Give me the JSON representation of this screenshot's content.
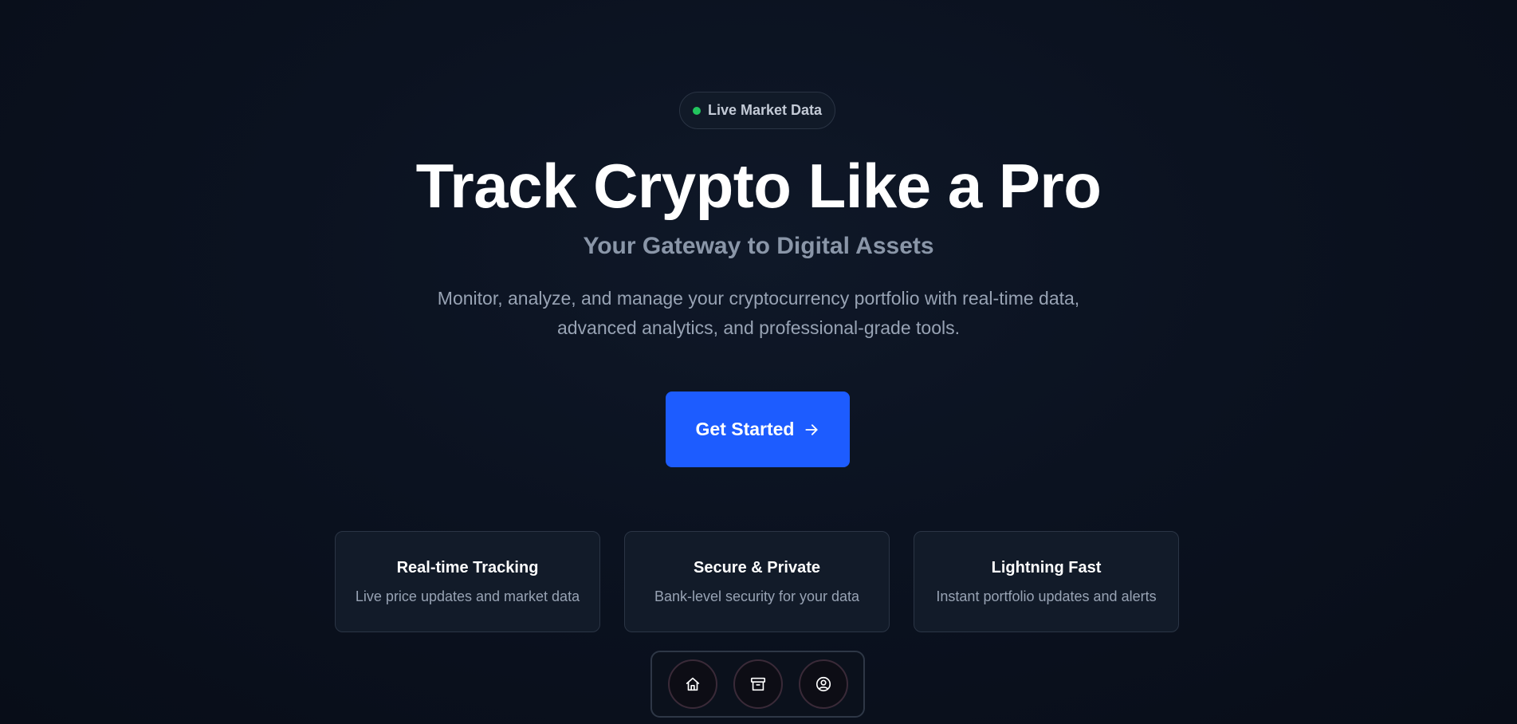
{
  "badge": {
    "label": "Live Market Data",
    "dot_color": "#22c55e"
  },
  "hero": {
    "title": "Track Crypto Like a Pro",
    "subtitle": "Your Gateway to Digital Assets",
    "description": "Monitor, analyze, and manage your cryptocurrency portfolio with real-time data, advanced analytics, and professional-grade tools."
  },
  "cta": {
    "label": "Get Started",
    "icon": "arrow-right-icon",
    "color": "#1d5cff"
  },
  "features": [
    {
      "title": "Real-time Tracking",
      "description": "Live price updates and market data"
    },
    {
      "title": "Secure & Private",
      "description": "Bank-level security for your data"
    },
    {
      "title": "Lightning Fast",
      "description": "Instant portfolio updates and alerts"
    }
  ],
  "bottom_nav": {
    "items": [
      {
        "icon": "home-icon"
      },
      {
        "icon": "archive-icon"
      },
      {
        "icon": "user-circle-icon"
      }
    ]
  }
}
